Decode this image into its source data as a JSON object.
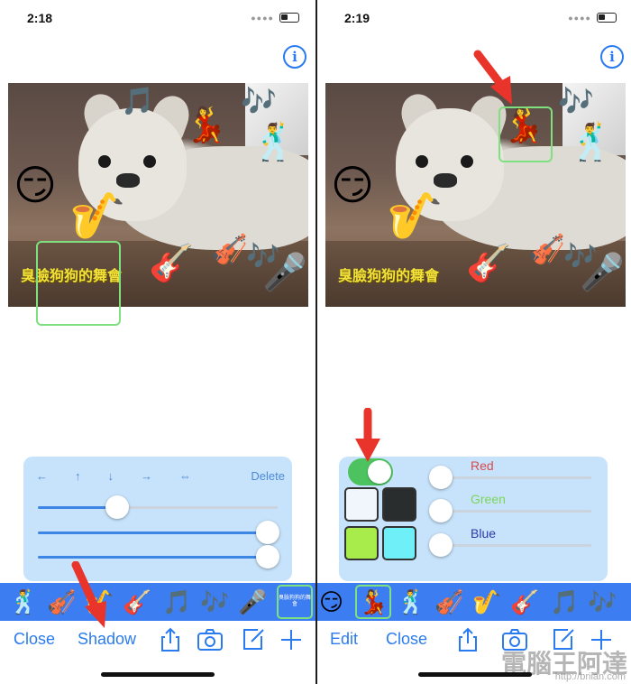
{
  "left": {
    "status_time": "2:18",
    "info_icon": "i",
    "caption": "臭臉狗狗的舞會",
    "controls": {
      "arrows": [
        "←",
        "↑",
        "↓",
        "→",
        "⇔"
      ],
      "delete_label": "Delete",
      "slider1": 0.33,
      "slider2": 0.96,
      "slider3": 0.96
    },
    "strip_text_sticker": "臭臉狗狗的舞會",
    "toolbar": {
      "close_label": "Close",
      "shadow_label": "Shadow"
    }
  },
  "right": {
    "status_time": "2:19",
    "info_icon": "i",
    "caption": "臭臉狗狗的舞會",
    "shadow_toggle_on": true,
    "swatch_colors": [
      "#f0f6fc",
      "#2a2d2e",
      "#a8ec4c",
      "#6ff0f8"
    ],
    "sliders": [
      {
        "label": "Red",
        "color": "#d94a4a"
      },
      {
        "label": "Green",
        "color": "#7cd65a"
      },
      {
        "label": "Blue",
        "color": "#2b3aa8"
      }
    ],
    "toolbar": {
      "edit_label": "Edit",
      "close_label": "Close"
    }
  },
  "stickers": {
    "music_note": "🎵",
    "music_notes": "🎶",
    "dancer_woman": "💃",
    "dancer_man": "🕺",
    "smirk_face": "😏",
    "saxophone": "🎷",
    "violin": "🎻",
    "guitar": "🎸",
    "microphone": "🎤"
  },
  "strip_left": [
    "🕺",
    "🎻",
    "🎷",
    "🎸",
    "🎵",
    "🎶",
    "🎤"
  ],
  "strip_right": [
    "😏",
    "💃",
    "🕺",
    "🎻",
    "🎷",
    "🎸",
    "🎵",
    "🎶"
  ],
  "watermark": "電腦王阿達",
  "watermark_url": "http://briian.com",
  "colors": {
    "accent": "#2b7bf0",
    "strip": "#3d7df2",
    "panel": "#c7e3fb",
    "selection": "#7fe07f",
    "arrow": "#e8342a"
  }
}
